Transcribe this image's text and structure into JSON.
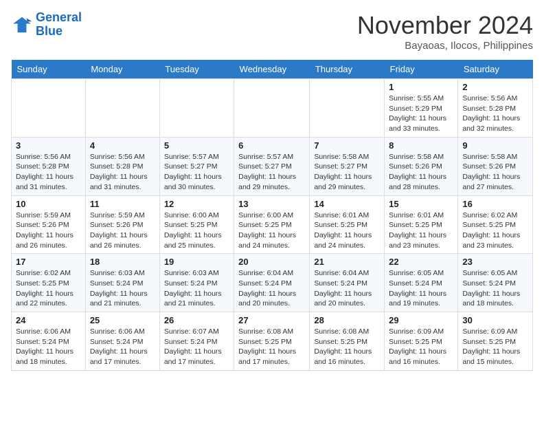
{
  "logo": {
    "line1": "General",
    "line2": "Blue"
  },
  "title": "November 2024",
  "location": "Bayaoas, Ilocos, Philippines",
  "days_of_week": [
    "Sunday",
    "Monday",
    "Tuesday",
    "Wednesday",
    "Thursday",
    "Friday",
    "Saturday"
  ],
  "weeks": [
    [
      {
        "day": "",
        "info": ""
      },
      {
        "day": "",
        "info": ""
      },
      {
        "day": "",
        "info": ""
      },
      {
        "day": "",
        "info": ""
      },
      {
        "day": "",
        "info": ""
      },
      {
        "day": "1",
        "info": "Sunrise: 5:55 AM\nSunset: 5:29 PM\nDaylight: 11 hours and 33 minutes."
      },
      {
        "day": "2",
        "info": "Sunrise: 5:56 AM\nSunset: 5:28 PM\nDaylight: 11 hours and 32 minutes."
      }
    ],
    [
      {
        "day": "3",
        "info": "Sunrise: 5:56 AM\nSunset: 5:28 PM\nDaylight: 11 hours and 31 minutes."
      },
      {
        "day": "4",
        "info": "Sunrise: 5:56 AM\nSunset: 5:28 PM\nDaylight: 11 hours and 31 minutes."
      },
      {
        "day": "5",
        "info": "Sunrise: 5:57 AM\nSunset: 5:27 PM\nDaylight: 11 hours and 30 minutes."
      },
      {
        "day": "6",
        "info": "Sunrise: 5:57 AM\nSunset: 5:27 PM\nDaylight: 11 hours and 29 minutes."
      },
      {
        "day": "7",
        "info": "Sunrise: 5:58 AM\nSunset: 5:27 PM\nDaylight: 11 hours and 29 minutes."
      },
      {
        "day": "8",
        "info": "Sunrise: 5:58 AM\nSunset: 5:26 PM\nDaylight: 11 hours and 28 minutes."
      },
      {
        "day": "9",
        "info": "Sunrise: 5:58 AM\nSunset: 5:26 PM\nDaylight: 11 hours and 27 minutes."
      }
    ],
    [
      {
        "day": "10",
        "info": "Sunrise: 5:59 AM\nSunset: 5:26 PM\nDaylight: 11 hours and 26 minutes."
      },
      {
        "day": "11",
        "info": "Sunrise: 5:59 AM\nSunset: 5:26 PM\nDaylight: 11 hours and 26 minutes."
      },
      {
        "day": "12",
        "info": "Sunrise: 6:00 AM\nSunset: 5:25 PM\nDaylight: 11 hours and 25 minutes."
      },
      {
        "day": "13",
        "info": "Sunrise: 6:00 AM\nSunset: 5:25 PM\nDaylight: 11 hours and 24 minutes."
      },
      {
        "day": "14",
        "info": "Sunrise: 6:01 AM\nSunset: 5:25 PM\nDaylight: 11 hours and 24 minutes."
      },
      {
        "day": "15",
        "info": "Sunrise: 6:01 AM\nSunset: 5:25 PM\nDaylight: 11 hours and 23 minutes."
      },
      {
        "day": "16",
        "info": "Sunrise: 6:02 AM\nSunset: 5:25 PM\nDaylight: 11 hours and 23 minutes."
      }
    ],
    [
      {
        "day": "17",
        "info": "Sunrise: 6:02 AM\nSunset: 5:25 PM\nDaylight: 11 hours and 22 minutes."
      },
      {
        "day": "18",
        "info": "Sunrise: 6:03 AM\nSunset: 5:24 PM\nDaylight: 11 hours and 21 minutes."
      },
      {
        "day": "19",
        "info": "Sunrise: 6:03 AM\nSunset: 5:24 PM\nDaylight: 11 hours and 21 minutes."
      },
      {
        "day": "20",
        "info": "Sunrise: 6:04 AM\nSunset: 5:24 PM\nDaylight: 11 hours and 20 minutes."
      },
      {
        "day": "21",
        "info": "Sunrise: 6:04 AM\nSunset: 5:24 PM\nDaylight: 11 hours and 20 minutes."
      },
      {
        "day": "22",
        "info": "Sunrise: 6:05 AM\nSunset: 5:24 PM\nDaylight: 11 hours and 19 minutes."
      },
      {
        "day": "23",
        "info": "Sunrise: 6:05 AM\nSunset: 5:24 PM\nDaylight: 11 hours and 18 minutes."
      }
    ],
    [
      {
        "day": "24",
        "info": "Sunrise: 6:06 AM\nSunset: 5:24 PM\nDaylight: 11 hours and 18 minutes."
      },
      {
        "day": "25",
        "info": "Sunrise: 6:06 AM\nSunset: 5:24 PM\nDaylight: 11 hours and 17 minutes."
      },
      {
        "day": "26",
        "info": "Sunrise: 6:07 AM\nSunset: 5:24 PM\nDaylight: 11 hours and 17 minutes."
      },
      {
        "day": "27",
        "info": "Sunrise: 6:08 AM\nSunset: 5:25 PM\nDaylight: 11 hours and 17 minutes."
      },
      {
        "day": "28",
        "info": "Sunrise: 6:08 AM\nSunset: 5:25 PM\nDaylight: 11 hours and 16 minutes."
      },
      {
        "day": "29",
        "info": "Sunrise: 6:09 AM\nSunset: 5:25 PM\nDaylight: 11 hours and 16 minutes."
      },
      {
        "day": "30",
        "info": "Sunrise: 6:09 AM\nSunset: 5:25 PM\nDaylight: 11 hours and 15 minutes."
      }
    ]
  ]
}
